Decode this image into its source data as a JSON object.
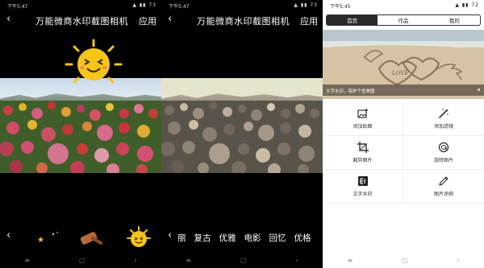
{
  "left_panel": {
    "status": {
      "time": "下午5:47",
      "signal": "▲ ▮▮ 73"
    },
    "topbar": {
      "back": "‹",
      "title": "万能微商水印截图相机",
      "apply": "应用"
    },
    "toolbar": {
      "back": "‹"
    },
    "sticker_items": [
      "star-sticker",
      "hammer-sticker",
      "sun-sticker"
    ],
    "nav": [
      "≡",
      "▢",
      "‹"
    ]
  },
  "middle_panel": {
    "status": {
      "time": "下午5:47",
      "signal": "▲ ▮▮ 73"
    },
    "topbar": {
      "back": "‹",
      "title": "万能微商水印截图相机",
      "apply": "应用"
    },
    "toolbar": {
      "back": "‹"
    },
    "filters": [
      "丽",
      "复古",
      "优雅",
      "电影",
      "回忆",
      "优格"
    ],
    "nav": [
      "≡",
      "▢",
      "‹"
    ]
  },
  "right_panel": {
    "status": {
      "time": "下午5:45",
      "signal": "▲ ▮▮ 72"
    },
    "tabs": [
      "首页",
      "作品",
      "我的"
    ],
    "banner_caption": "文字水印，保护个性美图",
    "grid": [
      {
        "label": "添加贴图",
        "icon": "add-image-icon"
      },
      {
        "label": "添加滤镜",
        "icon": "magic-wand-icon"
      },
      {
        "label": "截剪图片",
        "icon": "crop-icon"
      },
      {
        "label": "旋转图片",
        "icon": "rotate-icon"
      },
      {
        "label": "文字水印",
        "icon": "text-watermark-icon"
      },
      {
        "label": "图片涂鸦",
        "icon": "pencil-icon"
      }
    ],
    "nav": [
      "≡",
      "▢",
      "‹"
    ]
  },
  "colors": {
    "black": "#000000",
    "accent_dark": "#2a2a2a",
    "sun_yellow": "#f6c518"
  }
}
